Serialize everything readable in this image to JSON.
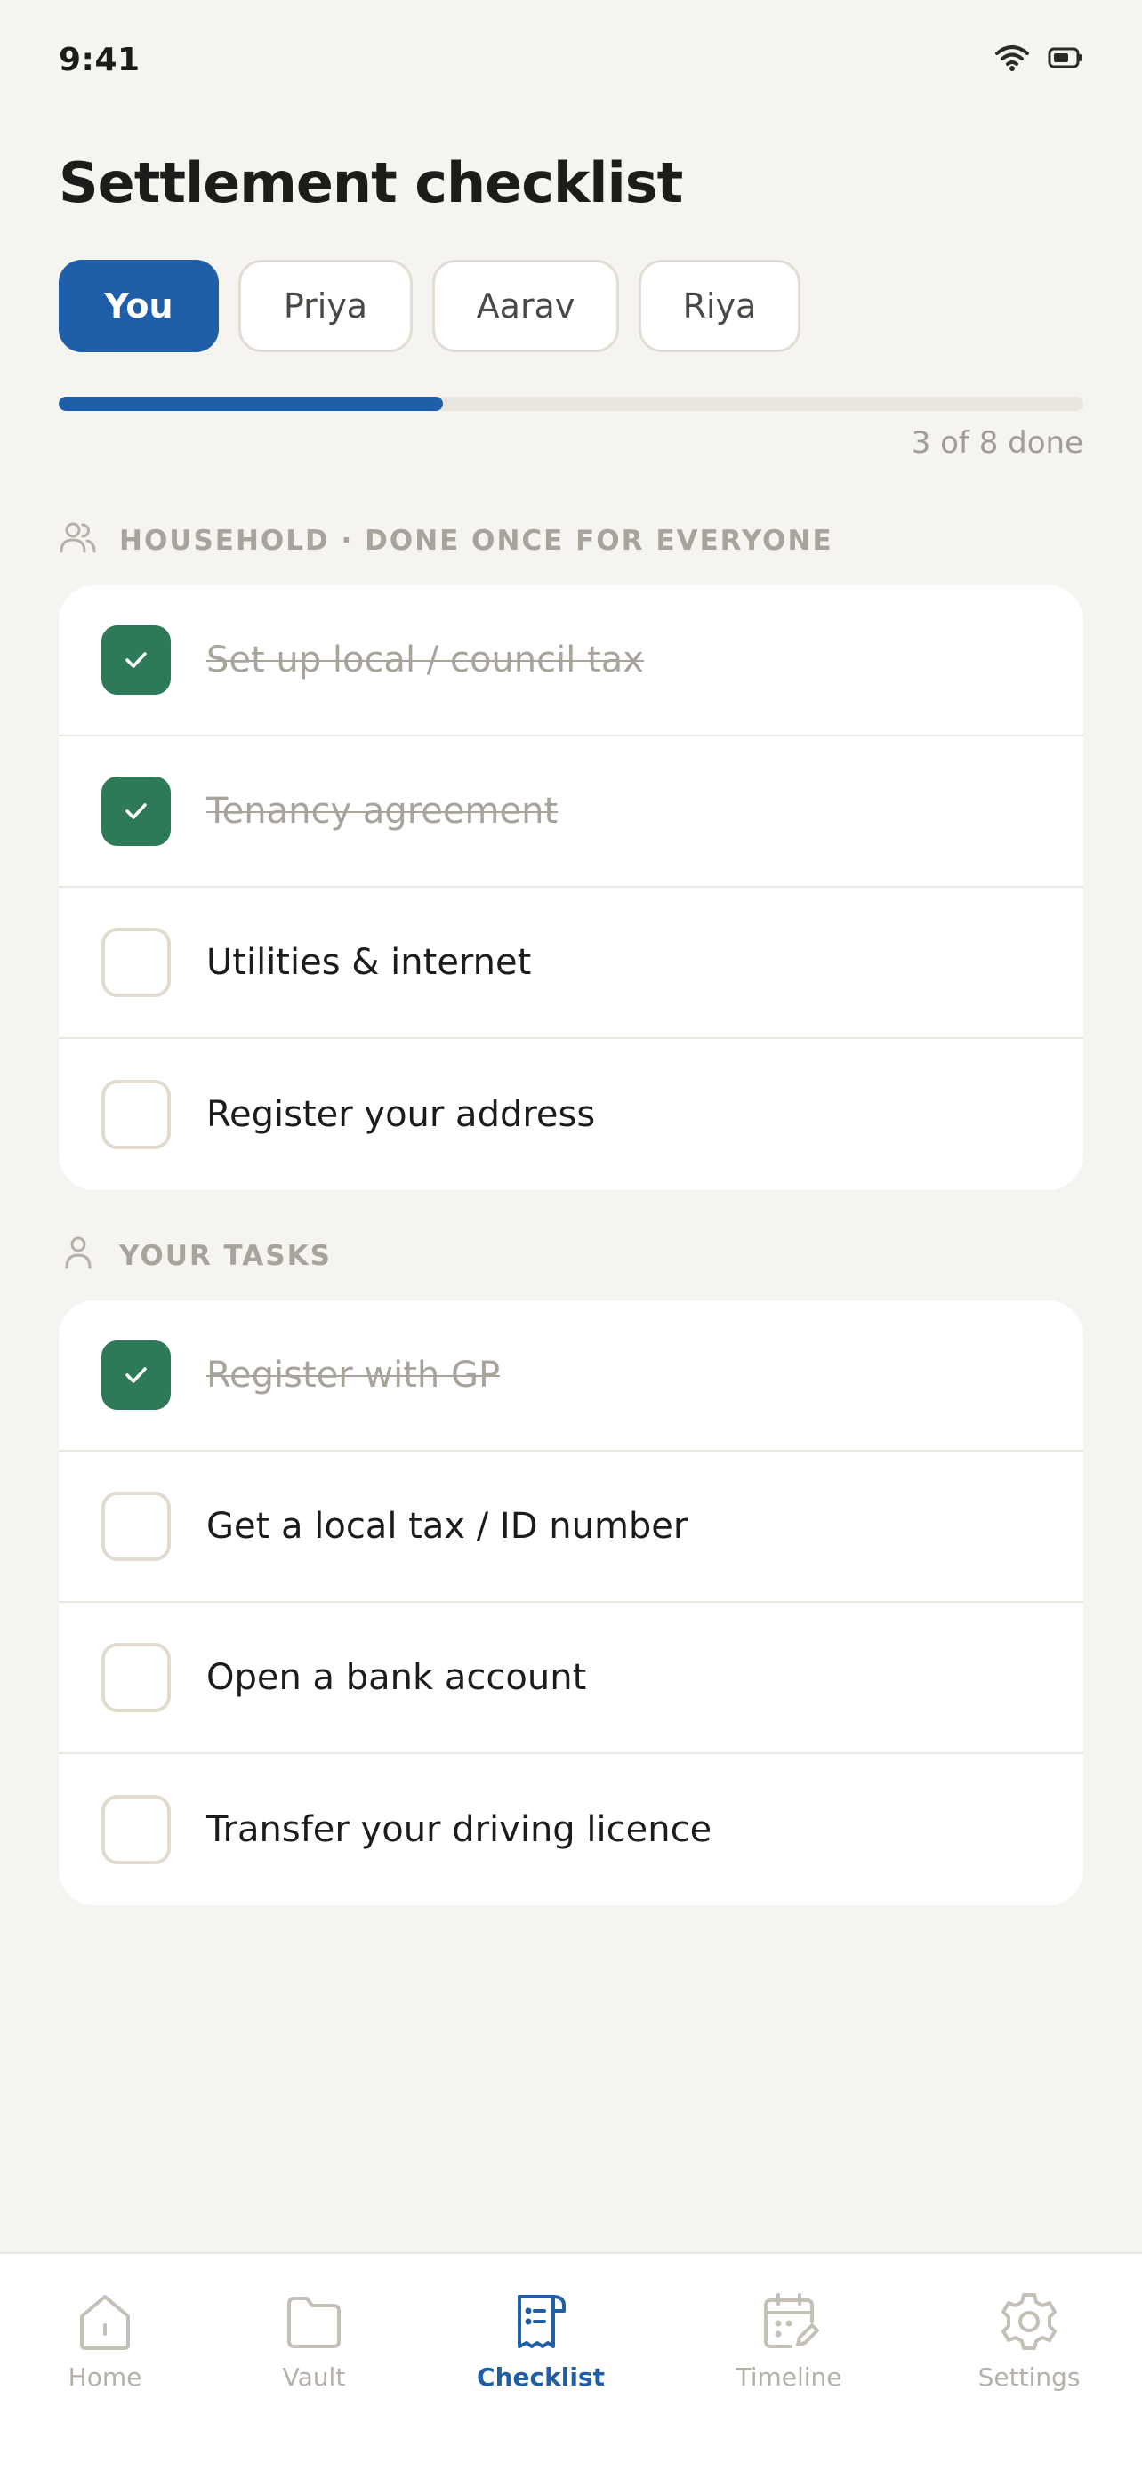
{
  "status_bar": {
    "time": "9:41",
    "icons": [
      "wifi-icon",
      "battery-icon"
    ]
  },
  "page": {
    "title": "Settlement checklist"
  },
  "tabs": [
    {
      "label": "You",
      "active": true
    },
    {
      "label": "Priya",
      "active": false
    },
    {
      "label": "Aarav",
      "active": false
    },
    {
      "label": "Riya",
      "active": false
    }
  ],
  "progress": {
    "done": 3,
    "total": 8,
    "fraction": 0.375,
    "label": "3 of 8 done"
  },
  "sections": {
    "household": {
      "icon": "people-icon",
      "title": "HOUSEHOLD · DONE ONCE FOR EVERYONE",
      "items": [
        {
          "label": "Set up local / council tax",
          "done": true
        },
        {
          "label": "Tenancy agreement",
          "done": true
        },
        {
          "label": "Utilities & internet",
          "done": false
        },
        {
          "label": "Register your address",
          "done": false
        }
      ]
    },
    "personal": {
      "icon": "person-icon",
      "title": "YOUR TASKS",
      "items": [
        {
          "label": "Register with GP",
          "done": true
        },
        {
          "label": "Get a local tax / ID number",
          "done": false
        },
        {
          "label": "Open a bank account",
          "done": false
        },
        {
          "label": "Transfer your driving licence",
          "done": false
        }
      ]
    }
  },
  "nav": {
    "items": [
      {
        "label": "Home",
        "icon": "home-icon",
        "active": false
      },
      {
        "label": "Vault",
        "icon": "folder-icon",
        "active": false
      },
      {
        "label": "Checklist",
        "icon": "checklist-icon",
        "active": true
      },
      {
        "label": "Timeline",
        "icon": "calendar-icon",
        "active": false
      },
      {
        "label": "Settings",
        "icon": "gear-icon",
        "active": false
      }
    ]
  },
  "colors": {
    "background": "#f5f4f0",
    "accent": "#1f5faa",
    "done": "#2e7a58",
    "muted": "#a8a49c"
  }
}
